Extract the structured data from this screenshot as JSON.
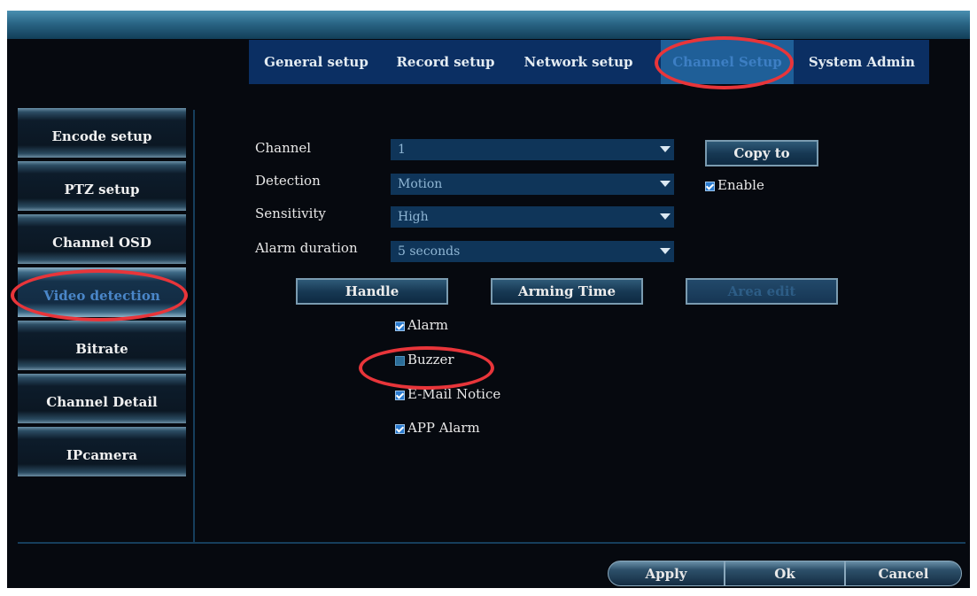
{
  "tabs": [
    {
      "label": "General setup"
    },
    {
      "label": "Record setup"
    },
    {
      "label": "Network setup"
    },
    {
      "label": "Channel Setup"
    },
    {
      "label": "System Admin"
    }
  ],
  "sidebar": {
    "items": [
      {
        "label": "Encode setup"
      },
      {
        "label": "PTZ setup"
      },
      {
        "label": "Channel OSD"
      },
      {
        "label": "Video detection"
      },
      {
        "label": "Bitrate"
      },
      {
        "label": "Channel Detail"
      },
      {
        "label": "IPcamera"
      }
    ]
  },
  "form": {
    "channel": {
      "label": "Channel",
      "value": "1"
    },
    "detection": {
      "label": "Detection",
      "value": "Motion"
    },
    "sensitivity": {
      "label": "Sensitivity",
      "value": "High"
    },
    "alarm_duration": {
      "label": "Alarm duration",
      "value": "5 seconds"
    },
    "copy_to": "Copy to",
    "enable": {
      "label": "Enable",
      "checked": true
    }
  },
  "actions": {
    "handle": "Handle",
    "arming_time": "Arming Time",
    "area_edit": "Area edit"
  },
  "checkboxes": [
    {
      "label": "Alarm",
      "checked": true
    },
    {
      "label": "Buzzer",
      "checked": false
    },
    {
      "label": "E-Mail Notice",
      "checked": true
    },
    {
      "label": "APP Alarm",
      "checked": true
    }
  ],
  "footer": {
    "apply": "Apply",
    "ok": "Ok",
    "cancel": "Cancel"
  },
  "colors": {
    "highlight_ring": "#e8353a",
    "active_text": "#3d7fc4"
  }
}
